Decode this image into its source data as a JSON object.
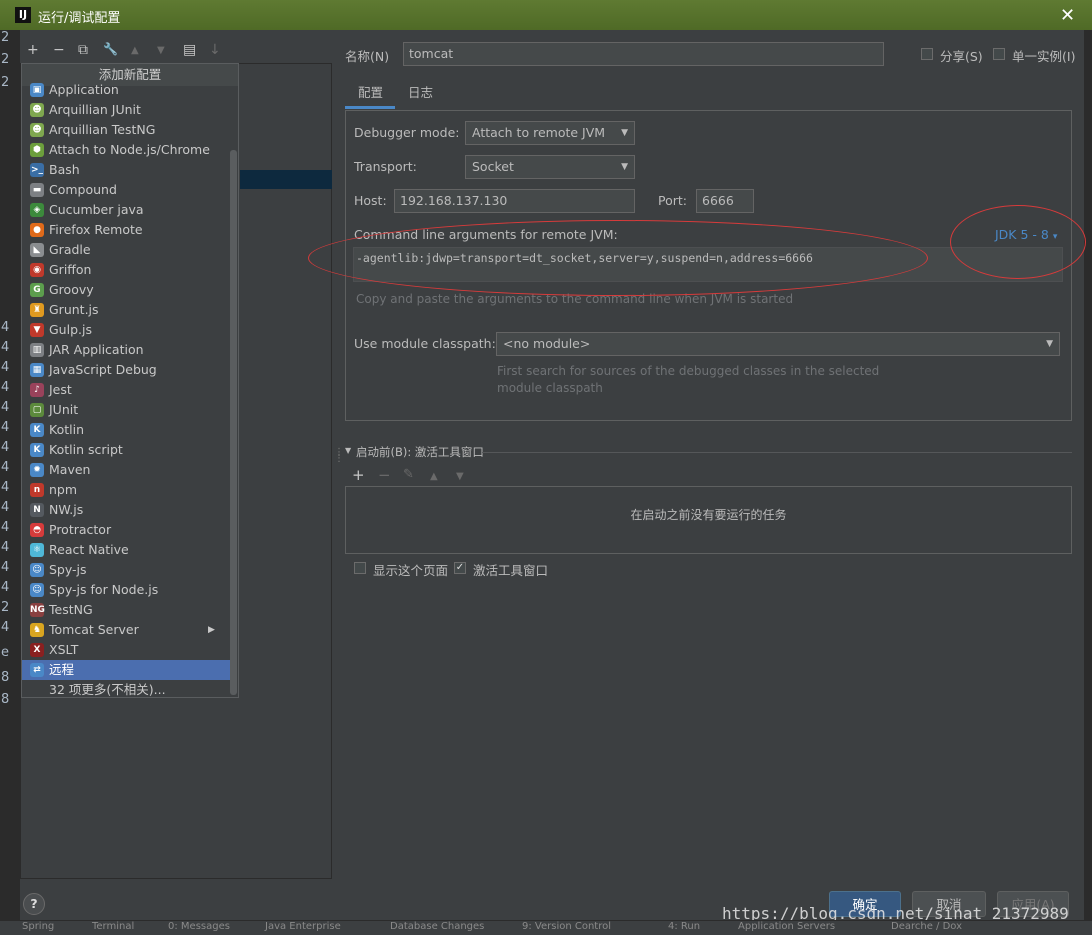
{
  "window": {
    "app_icon": "IJ",
    "title": "运行/调试配置",
    "close": "✕"
  },
  "gutter": {
    "chars": [
      "2",
      "2",
      "2",
      "4",
      "4",
      "4",
      "4",
      "4",
      "4",
      "4",
      "4",
      "4",
      "4",
      "4",
      "4",
      "4",
      "4",
      "2",
      "4",
      "e",
      "8",
      "8"
    ]
  },
  "left_toolbar": {
    "add": "+",
    "remove": "−",
    "copy": "⧉",
    "wrench": "🔧",
    "up": "▲",
    "down": "▼",
    "folder": "▤",
    "sort": "↓"
  },
  "popup": {
    "header": "添加新配置",
    "items": [
      {
        "label": "Application",
        "icon": "application-icon",
        "glyph": "▣",
        "color": "#4a88c7"
      },
      {
        "label": "Arquillian JUnit",
        "icon": "arquillian-icon",
        "glyph": "☻",
        "color": "#7fa84f"
      },
      {
        "label": "Arquillian TestNG",
        "icon": "arquillian-icon",
        "glyph": "☻",
        "color": "#7fa84f"
      },
      {
        "label": "Attach to Node.js/Chrome",
        "icon": "nodejs-icon",
        "glyph": "⬢",
        "color": "#6c9f3c"
      },
      {
        "label": "Bash",
        "icon": "bash-icon",
        "glyph": ">_",
        "color": "#3a6ea5"
      },
      {
        "label": "Compound",
        "icon": "folder-icon",
        "glyph": "▬",
        "color": "#7d8084"
      },
      {
        "label": "Cucumber java",
        "icon": "cucumber-icon",
        "glyph": "◈",
        "color": "#3c8a3c"
      },
      {
        "label": "Firefox Remote",
        "icon": "firefox-icon",
        "glyph": "●",
        "color": "#e06a1a"
      },
      {
        "label": "Gradle",
        "icon": "gradle-icon",
        "glyph": "◣",
        "color": "#8a8d90"
      },
      {
        "label": "Griffon",
        "icon": "griffon-icon",
        "glyph": "◉",
        "color": "#c0392b"
      },
      {
        "label": "Groovy",
        "icon": "groovy-icon",
        "glyph": "G",
        "color": "#5c9e4d"
      },
      {
        "label": "Grunt.js",
        "icon": "grunt-icon",
        "glyph": "♜",
        "color": "#e09a20"
      },
      {
        "label": "Gulp.js",
        "icon": "gulp-icon",
        "glyph": "▼",
        "color": "#c0392b"
      },
      {
        "label": "JAR Application",
        "icon": "jar-icon",
        "glyph": "▥",
        "color": "#7d8084"
      },
      {
        "label": "JavaScript Debug",
        "icon": "js-debug-icon",
        "glyph": "▦",
        "color": "#4a88c7"
      },
      {
        "label": "Jest",
        "icon": "jest-icon",
        "glyph": "♪",
        "color": "#99425b"
      },
      {
        "label": "JUnit",
        "icon": "junit-icon",
        "glyph": "▢",
        "color": "#5c8a3c"
      },
      {
        "label": "Kotlin",
        "icon": "kotlin-icon",
        "glyph": "K",
        "color": "#4a88c7"
      },
      {
        "label": "Kotlin script",
        "icon": "kotlin-icon",
        "glyph": "K",
        "color": "#4a88c7"
      },
      {
        "label": "Maven",
        "icon": "maven-icon",
        "glyph": "✹",
        "color": "#4a88c7"
      },
      {
        "label": "npm",
        "icon": "npm-icon",
        "glyph": "n",
        "color": "#c0392b"
      },
      {
        "label": "NW.js",
        "icon": "nwjs-icon",
        "glyph": "N",
        "color": "#555a60"
      },
      {
        "label": "Protractor",
        "icon": "protractor-icon",
        "glyph": "◓",
        "color": "#d63b3b"
      },
      {
        "label": "React Native",
        "icon": "react-icon",
        "glyph": "⚛",
        "color": "#4fb8d8"
      },
      {
        "label": "Spy-js",
        "icon": "spyjs-icon",
        "glyph": "☺",
        "color": "#4a88c7"
      },
      {
        "label": "Spy-js for Node.js",
        "icon": "spyjs-icon",
        "glyph": "☺",
        "color": "#4a88c7"
      },
      {
        "label": "TestNG",
        "icon": "testng-icon",
        "glyph": "NG",
        "color": "#8a4040"
      },
      {
        "label": "Tomcat Server",
        "icon": "tomcat-icon",
        "glyph": "♞",
        "color": "#d9a520",
        "submenu": "▶"
      },
      {
        "label": "XSLT",
        "icon": "xslt-icon",
        "glyph": "X",
        "color": "#8a2020"
      },
      {
        "label": "远程",
        "icon": "remote-icon",
        "glyph": "⇄",
        "color": "#4a88c7",
        "selected": true
      },
      {
        "label": "32 项更多(不相关)...",
        "icon": "",
        "glyph": "",
        "color": ""
      }
    ]
  },
  "header_row": {
    "name_label": "名称(N)",
    "name_value": "tomcat",
    "share_label": "分享(S)",
    "single_instance_label": "单一实例(I)"
  },
  "tabs": [
    {
      "label": "配置"
    },
    {
      "label": "日志"
    }
  ],
  "config": {
    "debugger_mode_label": "Debugger mode:",
    "debugger_mode_value": "Attach to remote JVM",
    "transport_label": "Transport:",
    "transport_value": "Socket",
    "host_label": "Host:",
    "host_value": "192.168.137.130",
    "port_label": "Port:",
    "port_value": "6666",
    "cmdline_label": "Command line arguments for remote JVM:",
    "jdk_link": "JDK 5 - 8",
    "cmdline_value": "-agentlib:jdwp=transport=dt_socket,server=y,suspend=n,address=6666",
    "cmdline_hint": "Copy and paste the arguments to the command line when JVM is started",
    "module_label": "Use module classpath:",
    "module_value": "<no module>",
    "module_hint_1": "First search for sources of the debugged classes in the selected",
    "module_hint_2": "module classpath"
  },
  "before_launch": {
    "title": "启动前(B): 激活工具窗口",
    "empty_text": "在启动之前没有要运行的任务",
    "toolbar": {
      "add": "+",
      "remove": "−",
      "edit": "✎",
      "up": "▲",
      "down": "▼"
    }
  },
  "options": {
    "show_page": "显示这个页面",
    "activate_window": "激活工具窗口"
  },
  "buttons": {
    "ok": "确定",
    "cancel": "取消",
    "apply": "应用(A)",
    "help": "?"
  },
  "watermark": "https://blog.csdn.net/sinat_21372989",
  "bottom_tabs": [
    "Spring",
    "Terminal",
    "0: Messages",
    "Java Enterprise",
    "Database Changes",
    "9: Version Control",
    "4: Run",
    "Application Servers",
    "Dearche / Dox"
  ],
  "colors": {
    "accent": "#4a88c7",
    "selected": "#4b6eaf",
    "annotation": "#d63b3b",
    "ok_button": "#365880"
  }
}
